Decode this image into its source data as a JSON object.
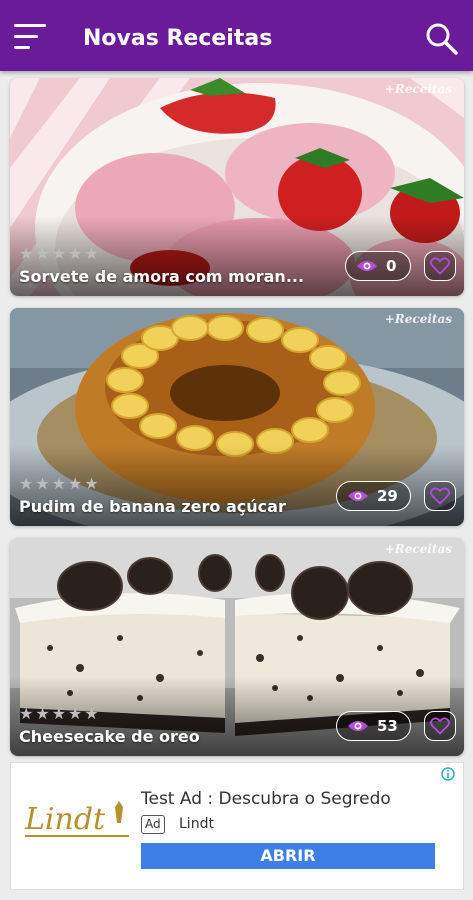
{
  "app_bar": {
    "title": "Novas Receitas",
    "background": "#6a1b9a",
    "menu_icon": "hamburger-menu-icon",
    "search_icon": "search-icon"
  },
  "recipes": [
    {
      "title": "Sorvete de amora com moran...",
      "views": "0",
      "rating": 0,
      "watermark": "+Receitas",
      "image": "strawberry-ice-cream-photo"
    },
    {
      "title": "Pudim de banana zero açúcar",
      "views": "29",
      "rating": 0,
      "watermark": "+Receitas",
      "image": "banana-pudding-photo"
    },
    {
      "title": "Cheesecake de oreo",
      "views": "53",
      "rating": 0,
      "watermark": "+Receitas",
      "image": "oreo-cheesecake-photo"
    }
  ],
  "colors": {
    "accent": "#b44bdc",
    "star_empty": "#bdbdbd",
    "ad_button": "#3d7fe6"
  },
  "ad": {
    "title": "Test Ad : Descubra o Segredo",
    "badge": "Ad",
    "advertiser": "Lindt",
    "cta": "ABRIR",
    "logo_text": "Lindt"
  }
}
